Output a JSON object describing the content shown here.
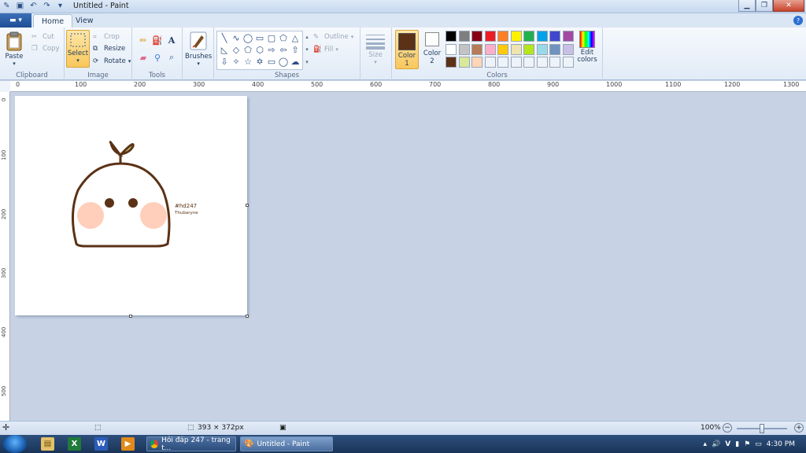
{
  "window": {
    "title": "Untitled - Paint"
  },
  "tabs": [
    {
      "label": "Home",
      "active": true
    },
    {
      "label": "View",
      "active": false
    }
  ],
  "ribbon": {
    "clipboard": {
      "label": "Clipboard",
      "paste": "Paste",
      "cut": "Cut",
      "copy": "Copy"
    },
    "image": {
      "label": "Image",
      "select": "Select",
      "crop": "Crop",
      "resize": "Resize",
      "rotate": "Rotate"
    },
    "tools": {
      "label": "Tools"
    },
    "brushes": {
      "label": "Brushes"
    },
    "shapes": {
      "label": "Shapes",
      "outline": "Outline",
      "fill": "Fill"
    },
    "size": {
      "label": "Size"
    },
    "colors": {
      "label": "Colors",
      "color1": "Color\n1",
      "color2": "Color\n2",
      "color1_label": "Color",
      "color1_num": "1",
      "color2_label": "Color",
      "color2_num": "2",
      "edit_colors": "Edit colors",
      "color1_value": "#5b3216",
      "color2_value": "#ffffff",
      "palette_row1": [
        "#000000",
        "#7f7f7f",
        "#880015",
        "#ed1c24",
        "#ff7f27",
        "#fff200",
        "#22b14c",
        "#00a2e8",
        "#3f48cc",
        "#a349a4"
      ],
      "palette_row2": [
        "#ffffff",
        "#c3c3c3",
        "#b97a57",
        "#ffaec9",
        "#ffc90e",
        "#efe4b0",
        "#b5e61d",
        "#99d9ea",
        "#7092be",
        "#c8bfe7"
      ],
      "palette_row3": [
        "#5b3216",
        "#d9e89a",
        "#ffd5b8",
        "#eef3fa",
        "#eef3fa",
        "#eef3fa",
        "#eef3fa",
        "#eef3fa",
        "#eef3fa",
        "#eef3fa"
      ]
    }
  },
  "ruler": {
    "h_ticks": [
      "0",
      "100",
      "200",
      "300",
      "400",
      "500",
      "600",
      "700",
      "800",
      "900",
      "1000",
      "1100",
      "1200",
      "1300"
    ],
    "v_ticks": [
      "0",
      "100",
      "200",
      "300",
      "400",
      "500"
    ]
  },
  "canvas": {
    "drawing_text_1": "#hd247",
    "drawing_text_2": "Thubaryne"
  },
  "status": {
    "dimensions": "393 × 372px",
    "zoom": "100%"
  },
  "taskbar": {
    "tasks": [
      {
        "label": "Hỏi đáp 247 - trang t...",
        "active": false
      },
      {
        "label": "Untitled - Paint",
        "active": true
      }
    ],
    "time": "4:30 PM"
  }
}
